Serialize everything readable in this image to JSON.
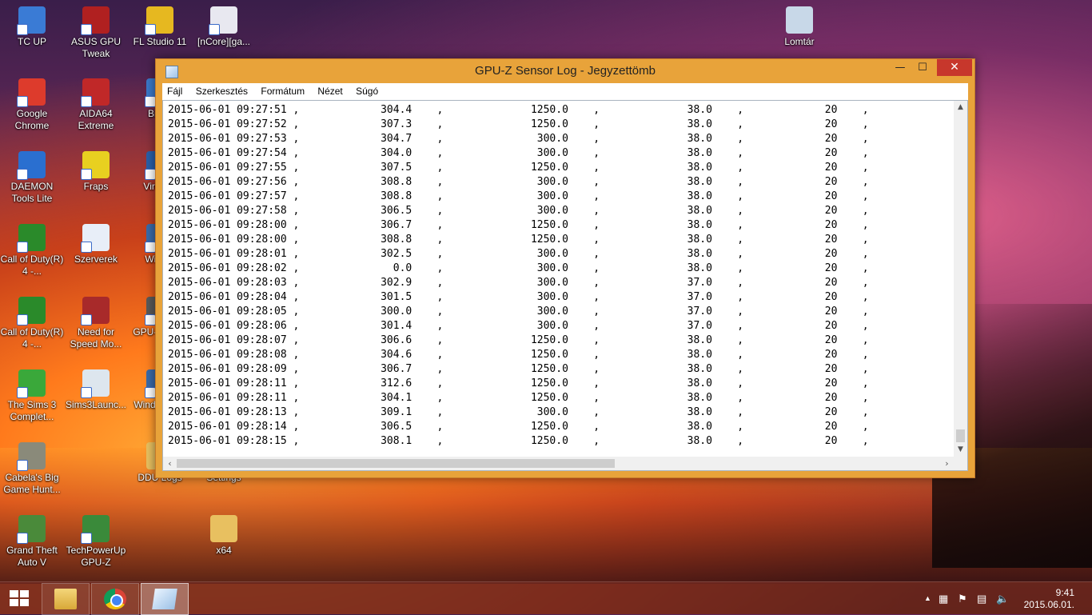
{
  "desktop": {
    "icons": [
      {
        "label": "TC UP",
        "color": "#3a7bd5"
      },
      {
        "label": "ASUS GPU Tweak",
        "color": "#b02020"
      },
      {
        "label": "FL Studio 11",
        "color": "#e6b820"
      },
      {
        "label": "[nCore][ga...",
        "color": "#e8e8f0"
      },
      {
        "label": "Lomtár",
        "color": "#c8d8e8"
      },
      {
        "label": "Google Chrome",
        "color": "#dd3b2c"
      },
      {
        "label": "AIDA64 Extreme",
        "color": "#c02828"
      },
      {
        "label": "BitT...",
        "color": "#3a78c8"
      },
      {
        "label": "DAEMON Tools Lite",
        "color": "#2a6fd0"
      },
      {
        "label": "Fraps",
        "color": "#e8d020"
      },
      {
        "label": "Virtua...",
        "color": "#2a5fa8"
      },
      {
        "label": "Call of Duty(R) 4 -...",
        "color": "#2a8a2a"
      },
      {
        "label": "Szerverek",
        "color": "#e8eef8"
      },
      {
        "label": "Wind...",
        "color": "#3a6aa8"
      },
      {
        "label": "Call of Duty(R) 4 -...",
        "color": "#2a8a2a"
      },
      {
        "label": "Need for Speed Mo...",
        "color": "#a82a2a"
      },
      {
        "label": "GPU-Z... L...",
        "color": "#5a5a5a"
      },
      {
        "label": "The Sims 3 Complet...",
        "color": "#3aa83a"
      },
      {
        "label": "Sims3Launc...",
        "color": "#dde6ee"
      },
      {
        "label": "Wind... USB",
        "color": "#3a6aa8"
      },
      {
        "label": "Cabela's Big Game Hunt...",
        "color": "#8a8a7a"
      },
      {
        "label": "DDU Logs",
        "color": "#e8c060"
      },
      {
        "label": "Settings",
        "color": "#a8a8a8"
      },
      {
        "label": "Grand Theft Auto V",
        "color": "#4a8a3a"
      },
      {
        "label": "TechPowerUp GPU-Z",
        "color": "#3a8a3a"
      },
      {
        "label": "x64",
        "color": "#e8c060"
      }
    ]
  },
  "window": {
    "title": "GPU-Z Sensor Log - Jegyzettömb",
    "minimize": "—",
    "maximize": "☐",
    "close": "✕",
    "menu": [
      "Fájl",
      "Szerkesztés",
      "Formátum",
      "Nézet",
      "Súgó"
    ]
  },
  "log_lines": [
    "2015-06-01 09:27:51 ,             304.4    ,              1250.0    ,              38.0    ,             20    ,",
    "2015-06-01 09:27:52 ,             307.3    ,              1250.0    ,              38.0    ,             20    ,",
    "2015-06-01 09:27:53 ,             304.7    ,               300.0    ,              38.0    ,             20    ,",
    "2015-06-01 09:27:54 ,             304.0    ,               300.0    ,              38.0    ,             20    ,",
    "2015-06-01 09:27:55 ,             307.5    ,              1250.0    ,              38.0    ,             20    ,",
    "2015-06-01 09:27:56 ,             308.8    ,               300.0    ,              38.0    ,             20    ,",
    "2015-06-01 09:27:57 ,             308.8    ,               300.0    ,              38.0    ,             20    ,",
    "2015-06-01 09:27:58 ,             306.5    ,               300.0    ,              38.0    ,             20    ,",
    "2015-06-01 09:28:00 ,             306.7    ,              1250.0    ,              38.0    ,             20    ,",
    "2015-06-01 09:28:00 ,             308.8    ,              1250.0    ,              38.0    ,             20    ,",
    "2015-06-01 09:28:01 ,             302.5    ,               300.0    ,              38.0    ,             20    ,",
    "2015-06-01 09:28:02 ,               0.0    ,               300.0    ,              38.0    ,             20    ,",
    "2015-06-01 09:28:03 ,             302.9    ,               300.0    ,              37.0    ,             20    ,",
    "2015-06-01 09:28:04 ,             301.5    ,               300.0    ,              37.0    ,             20    ,",
    "2015-06-01 09:28:05 ,             300.0    ,               300.0    ,              37.0    ,             20    ,",
    "2015-06-01 09:28:06 ,             301.4    ,               300.0    ,              37.0    ,             20    ,",
    "2015-06-01 09:28:07 ,             306.6    ,              1250.0    ,              38.0    ,             20    ,",
    "2015-06-01 09:28:08 ,             304.6    ,              1250.0    ,              38.0    ,             20    ,",
    "2015-06-01 09:28:09 ,             306.7    ,              1250.0    ,              38.0    ,             20    ,",
    "2015-06-01 09:28:11 ,             312.6    ,              1250.0    ,              38.0    ,             20    ,",
    "2015-06-01 09:28:11 ,             304.1    ,              1250.0    ,              38.0    ,             20    ,",
    "2015-06-01 09:28:13 ,             309.1    ,               300.0    ,              38.0    ,             20    ,",
    "2015-06-01 09:28:14 ,             306.5    ,              1250.0    ,              38.0    ,             20    ,",
    "2015-06-01 09:28:15 ,             308.1    ,              1250.0    ,              38.0    ,             20    ,"
  ],
  "scrollbars": {
    "up": "▲",
    "down": "▼",
    "left": "‹",
    "right": "›"
  },
  "taskbar": {
    "tray_arrow": "▲",
    "clock_time": "9:41",
    "clock_date": "2015.06.01."
  }
}
